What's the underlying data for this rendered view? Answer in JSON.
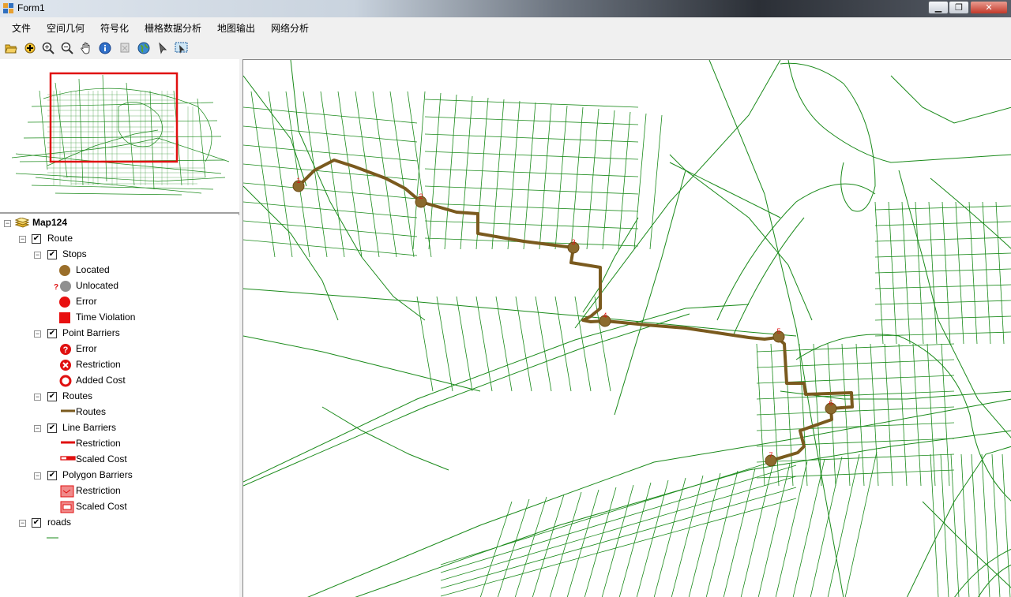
{
  "window": {
    "title": "Form1"
  },
  "menu": [
    "文件",
    "空间几何",
    "符号化",
    "栅格数据分析",
    "地图输出",
    "网络分析"
  ],
  "toolbar": [
    "open-folder-icon",
    "add-data-icon",
    "zoom-in-icon",
    "zoom-out-icon",
    "pan-hand-icon",
    "identify-info-icon",
    "full-extent-icon",
    "globe-icon",
    "select-arrow-icon",
    "select-features-icon"
  ],
  "toc": {
    "map": "Map124",
    "route_layer": "Route",
    "stops": {
      "label": "Stops",
      "items": [
        "Located",
        "Unlocated",
        "Error",
        "Time Violation"
      ]
    },
    "point_barriers": {
      "label": "Point Barriers",
      "items": [
        "Error",
        "Restriction",
        "Added Cost"
      ]
    },
    "routes": {
      "label": "Routes",
      "items": [
        "Routes"
      ]
    },
    "line_barriers": {
      "label": "Line Barriers",
      "items": [
        "Restriction",
        "Scaled Cost"
      ]
    },
    "polygon_barriers": {
      "label": "Polygon Barriers",
      "items": [
        "Restriction",
        "Scaled Cost"
      ]
    },
    "roads": "roads"
  },
  "map": {
    "stops": [
      "1",
      "2",
      "3",
      "4",
      "5",
      "6",
      "7"
    ]
  },
  "colors": {
    "route": "#7a5a1e",
    "roads": "#1a8a1a",
    "stop": "#8b6a2e",
    "stop_label": "#e01010",
    "extent_box": "#e01010"
  }
}
